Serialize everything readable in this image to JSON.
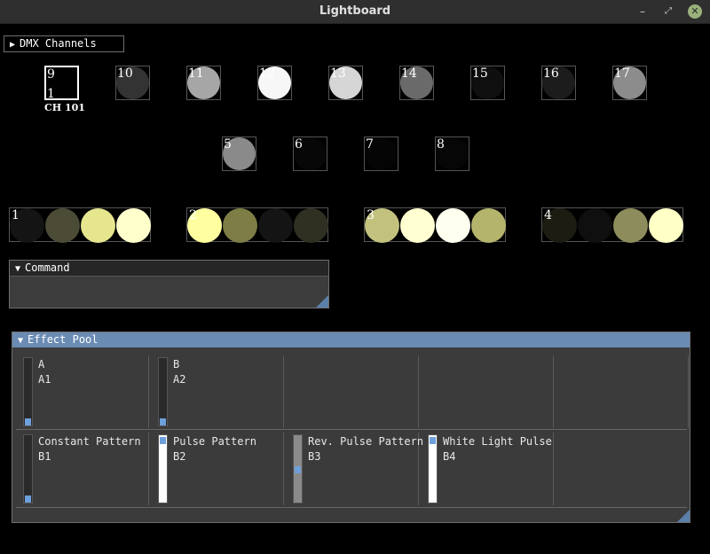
{
  "window": {
    "title": "Lightboard",
    "minimize": "–",
    "maximize": "⤢",
    "close": "✕"
  },
  "dmx_panel": {
    "arrow": "▶",
    "label": "DMX Channels"
  },
  "fixtures_row1": [
    {
      "num": "9",
      "sub": "1",
      "channel": "CH 101",
      "color": "#000000",
      "selected": true
    },
    {
      "num": "10",
      "color": "#333333"
    },
    {
      "num": "11",
      "color": "#a6a6a6"
    },
    {
      "num": "12",
      "color": "#f7f7f7"
    },
    {
      "num": "13",
      "color": "#d6d6d6"
    },
    {
      "num": "14",
      "color": "#6a6a6a"
    },
    {
      "num": "15",
      "color": "#0f0f0f"
    },
    {
      "num": "16",
      "color": "#1c1c1c"
    },
    {
      "num": "17",
      "color": "#8c8c8c"
    }
  ],
  "fixtures_row2": [
    {
      "num": "5",
      "color": "#8a8a8a"
    },
    {
      "num": "6",
      "color": "#070707"
    },
    {
      "num": "7",
      "color": "#050505"
    },
    {
      "num": "8",
      "color": "#060606"
    }
  ],
  "bars": [
    {
      "num": "1",
      "lamps": [
        "#141414",
        "#4c4c36",
        "#e6e68e",
        "#ffffcc"
      ]
    },
    {
      "num": "2",
      "lamps": [
        "#ffffa0",
        "#7d7d45",
        "#141414",
        "#2f2f22"
      ]
    },
    {
      "num": "3",
      "lamps": [
        "#c2c27e",
        "#ffffd2",
        "#fffff0",
        "#b4b46c"
      ]
    },
    {
      "num": "4",
      "lamps": [
        "#1c1c12",
        "#0f0f0f",
        "#8c8c5d",
        "#ffffc6"
      ]
    }
  ],
  "command_panel": {
    "arrow": "▼",
    "label": "Command"
  },
  "effect_pool": {
    "arrow": "▼",
    "label": "Effect Pool",
    "row1": [
      {
        "name": "A",
        "id": "A1",
        "level": 0
      },
      {
        "name": "B",
        "id": "A2",
        "level": 0
      },
      {
        "name": "",
        "id": "",
        "empty": true
      },
      {
        "name": "",
        "id": "",
        "empty": true
      },
      {
        "name": "",
        "id": "",
        "empty": true
      }
    ],
    "row2": [
      {
        "name": "Constant Pattern",
        "id": "B1",
        "level": 0
      },
      {
        "name": "Pulse Pattern",
        "id": "B2",
        "level": 1.0
      },
      {
        "name": "Rev. Pulse Pattern",
        "id": "B3",
        "level": 0.5,
        "dim": true
      },
      {
        "name": "White Light Pulse",
        "id": "B4",
        "level": 1.0
      }
    ]
  }
}
